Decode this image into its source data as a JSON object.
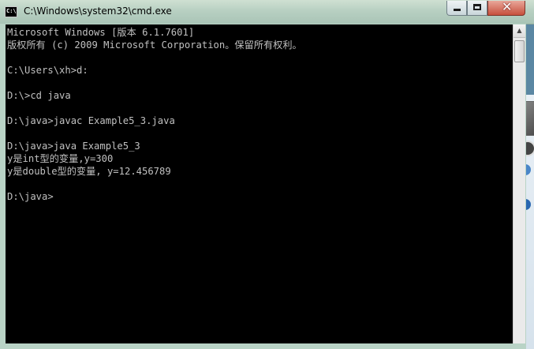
{
  "window": {
    "title": "C:\\Windows\\system32\\cmd.exe",
    "close_glyph": "✕"
  },
  "console": {
    "lines": [
      "Microsoft Windows [版本 6.1.7601]",
      "版权所有 (c) 2009 Microsoft Corporation。保留所有权利。",
      "",
      "C:\\Users\\xh>d:",
      "",
      "D:\\>cd java",
      "",
      "D:\\java>javac Example5_3.java",
      "",
      "D:\\java>java Example5_3",
      "y是int型的变量,y=300",
      "y是double型的变量, y=12.456789",
      "",
      "D:\\java>"
    ]
  },
  "scrollbar": {
    "up_arrow": "▲"
  },
  "side_panel": {
    "info_glyph": "i"
  },
  "colors": {
    "console_bg": "#000000",
    "console_fg": "#c0c0c0",
    "close_button": "#c7503d"
  }
}
